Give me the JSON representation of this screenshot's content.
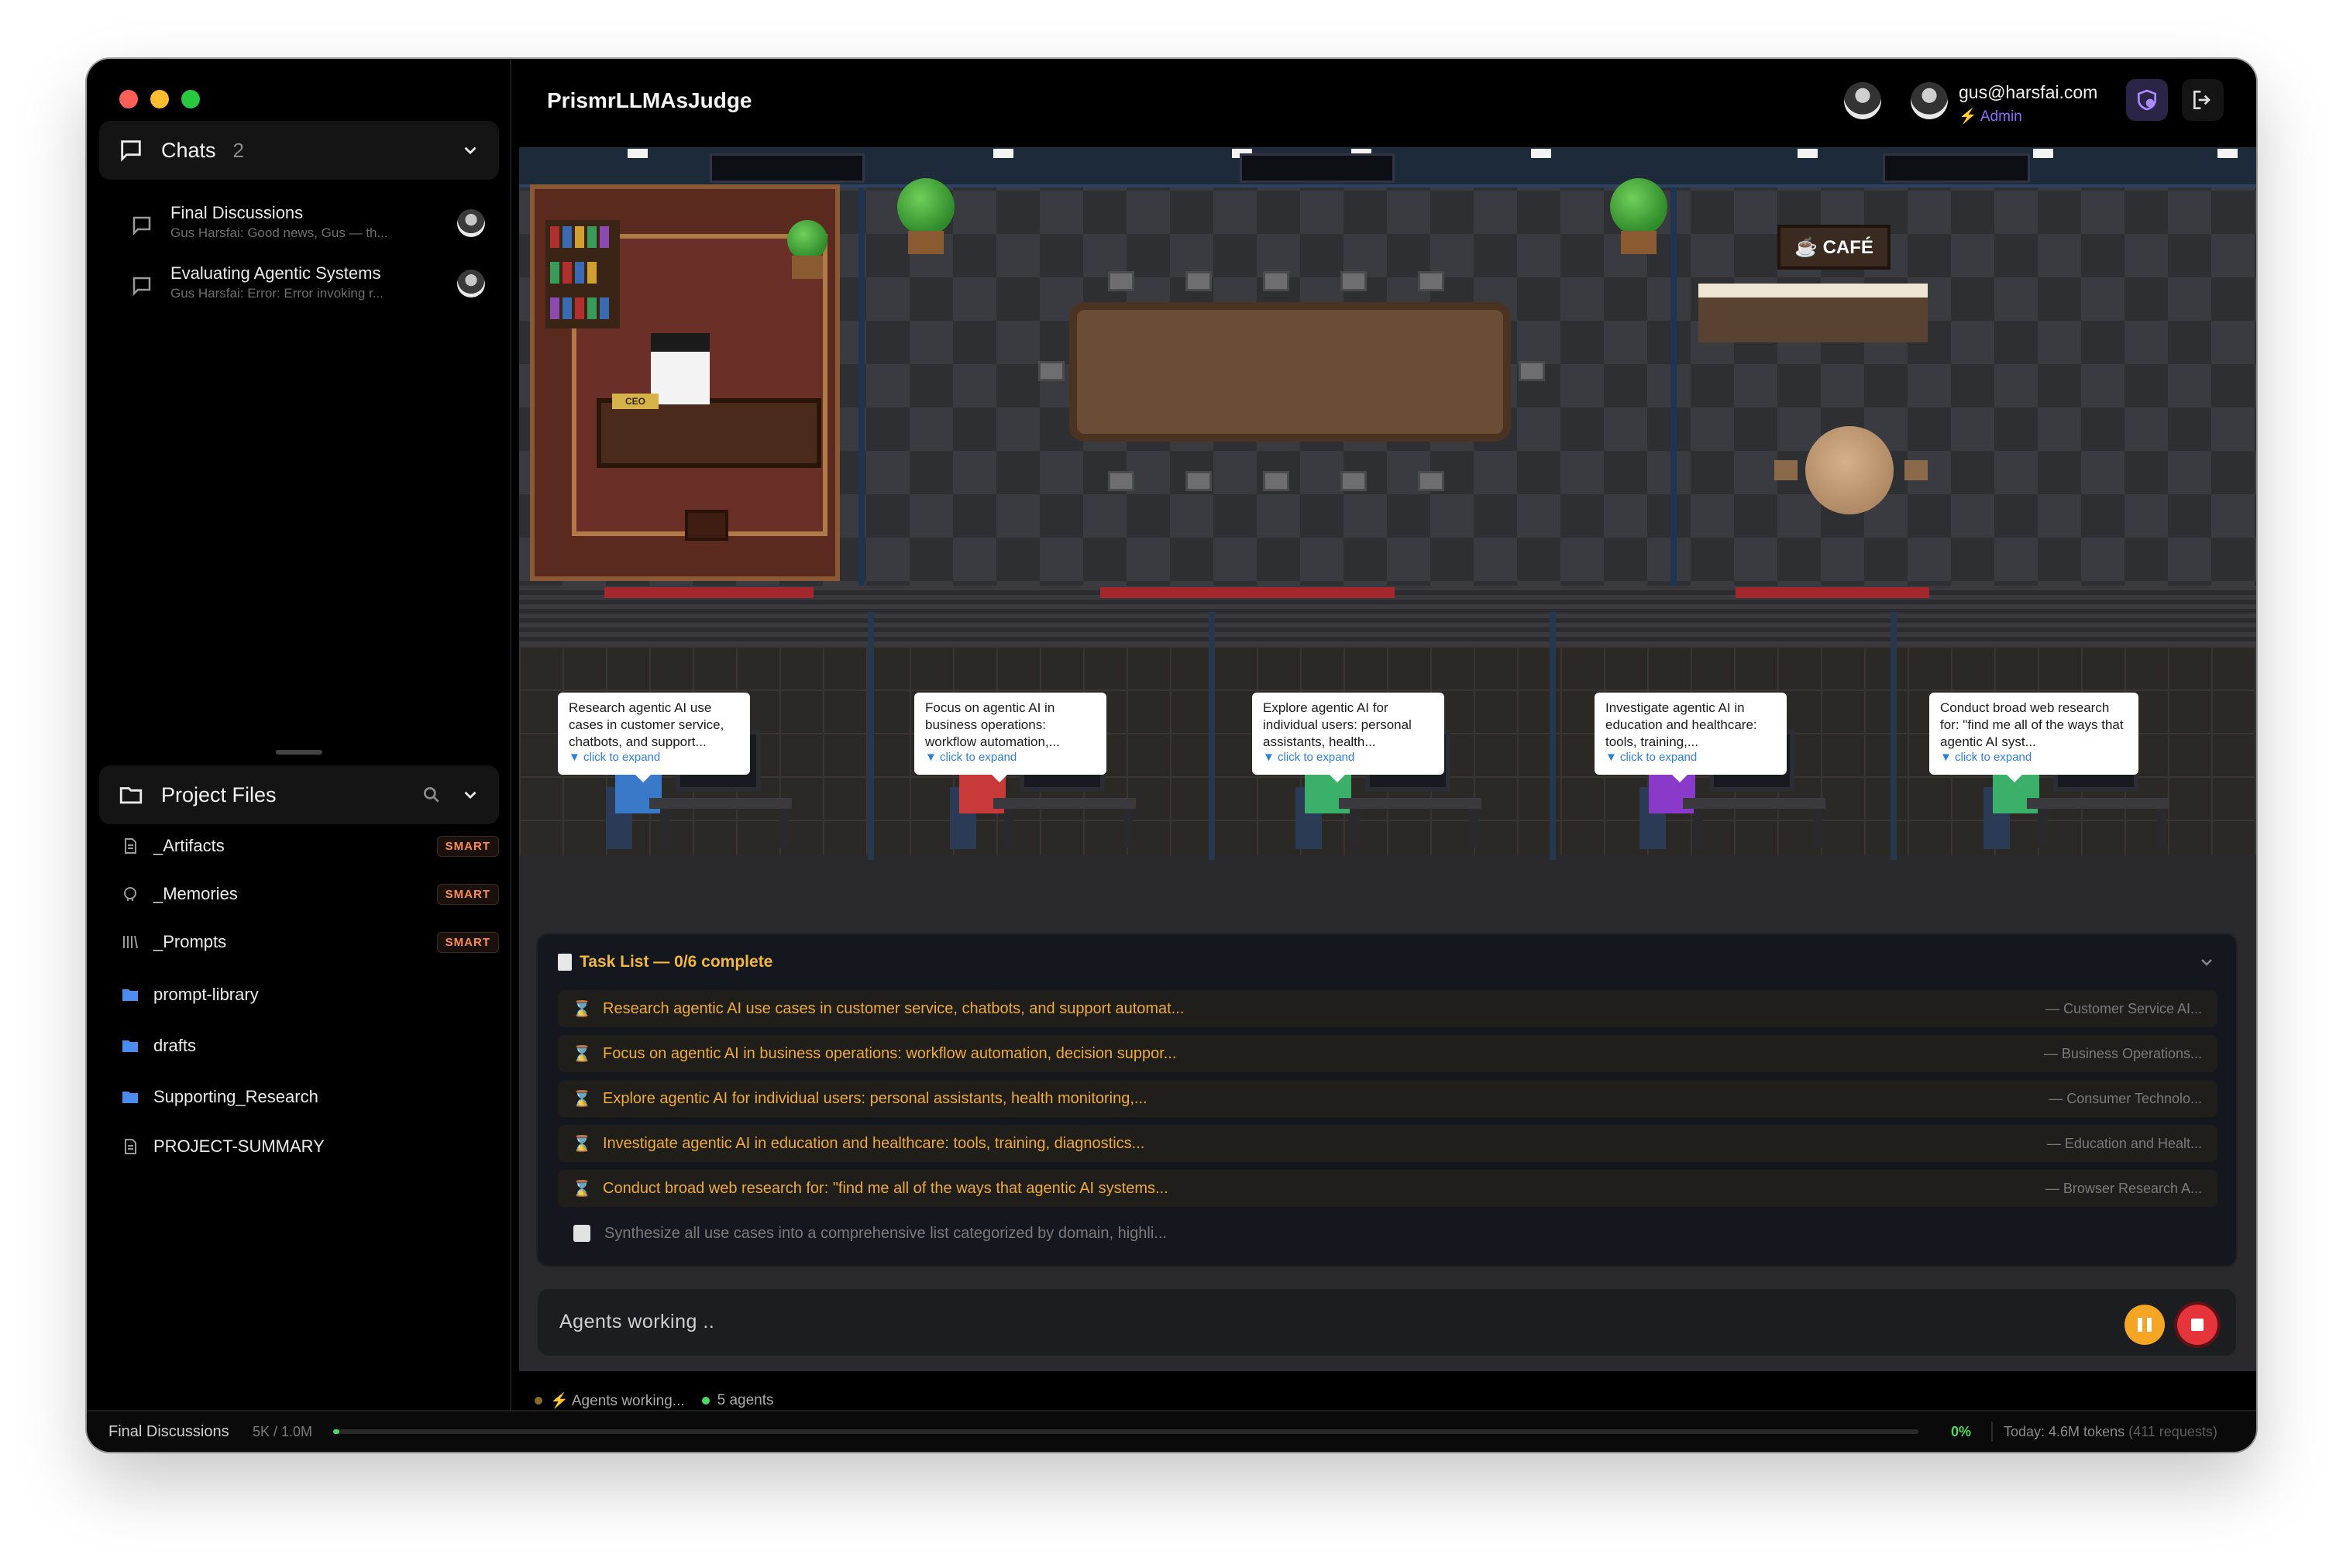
{
  "window": {
    "title": "PrismrLLMAsJudge"
  },
  "sidebar": {
    "chats": {
      "title": "Chats",
      "count": "2",
      "items": [
        {
          "title": "Final Discussions",
          "subtitle": "Gus Harsfai: Good news, Gus — th..."
        },
        {
          "title": "Evaluating Agentic Systems",
          "subtitle": "Gus Harsfai: Error: Error invoking r..."
        }
      ]
    },
    "files": {
      "title": "Project Files",
      "items": [
        {
          "label": "_Artifacts",
          "icon": "document-icon",
          "badge": "SMART"
        },
        {
          "label": "_Memories",
          "icon": "brain-icon",
          "badge": "SMART"
        },
        {
          "label": "_Prompts",
          "icon": "library-icon",
          "badge": "SMART"
        },
        {
          "label": "prompt-library",
          "icon": "folder-icon"
        },
        {
          "label": "drafts",
          "icon": "folder-icon"
        },
        {
          "label": "Supporting_Research",
          "icon": "folder-icon"
        },
        {
          "label": "PROJECT-SUMMARY",
          "icon": "document-icon"
        }
      ]
    }
  },
  "header": {
    "user_email": "gus@harsfai.com",
    "user_role": "⚡ Admin"
  },
  "scene": {
    "cafe_sign": "☕ CAFÉ",
    "ceo_sign": "CEO",
    "bubbles": [
      {
        "text": "Research agentic AI use cases in customer service, chatbots, and support...",
        "expand": "▼ click to expand"
      },
      {
        "text": "Focus on agentic AI in business operations: workflow automation,...",
        "expand": "▼ click to expand"
      },
      {
        "text": "Explore agentic AI for individual users: personal assistants, health...",
        "expand": "▼ click to expand"
      },
      {
        "text": "Investigate agentic AI in education and healthcare: tools, training,...",
        "expand": "▼ click to expand"
      },
      {
        "text": "Conduct broad web research for: \"find me all of the ways that agentic AI syst...",
        "expand": "▼ click to expand"
      }
    ]
  },
  "tasks": {
    "header": "Task List — 0/6 complete",
    "items": [
      {
        "text": "Research agentic AI use cases in customer service, chatbots, and support automat...",
        "agent": "— Customer Service AI...",
        "status": "in-progress"
      },
      {
        "text": "Focus on agentic AI in business operations: workflow automation, decision suppor...",
        "agent": "— Business Operations...",
        "status": "in-progress"
      },
      {
        "text": "Explore agentic AI for individual users: personal assistants, health monitoring,...",
        "agent": "— Consumer Technolo...",
        "status": "in-progress"
      },
      {
        "text": "Investigate agentic AI in education and healthcare: tools, training, diagnostics...",
        "agent": "— Education and Healt...",
        "status": "in-progress"
      },
      {
        "text": "Conduct broad web research for: \"find me all of the ways that agentic AI systems...",
        "agent": "— Browser Research A...",
        "status": "in-progress"
      },
      {
        "text": "Synthesize all use cases into a comprehensive list categorized by domain, highli...",
        "agent": "",
        "status": "pending"
      }
    ]
  },
  "composer": {
    "status": "Agents working .."
  },
  "agent_status": {
    "working": "⚡ Agents working...",
    "agents": "5 agents"
  },
  "footer": {
    "chat": "Final Discussions",
    "context": "5K / 1.0M",
    "percent": "0%",
    "today": "Today: 4.6M tokens",
    "requests": "(411 requests)"
  },
  "colors": {
    "accent": "#f3b73f",
    "admin": "#8d6bff",
    "smart": "#ff8a4c",
    "stop": "#e5343a",
    "pause": "#f5a524",
    "progress": "#4cd964"
  }
}
